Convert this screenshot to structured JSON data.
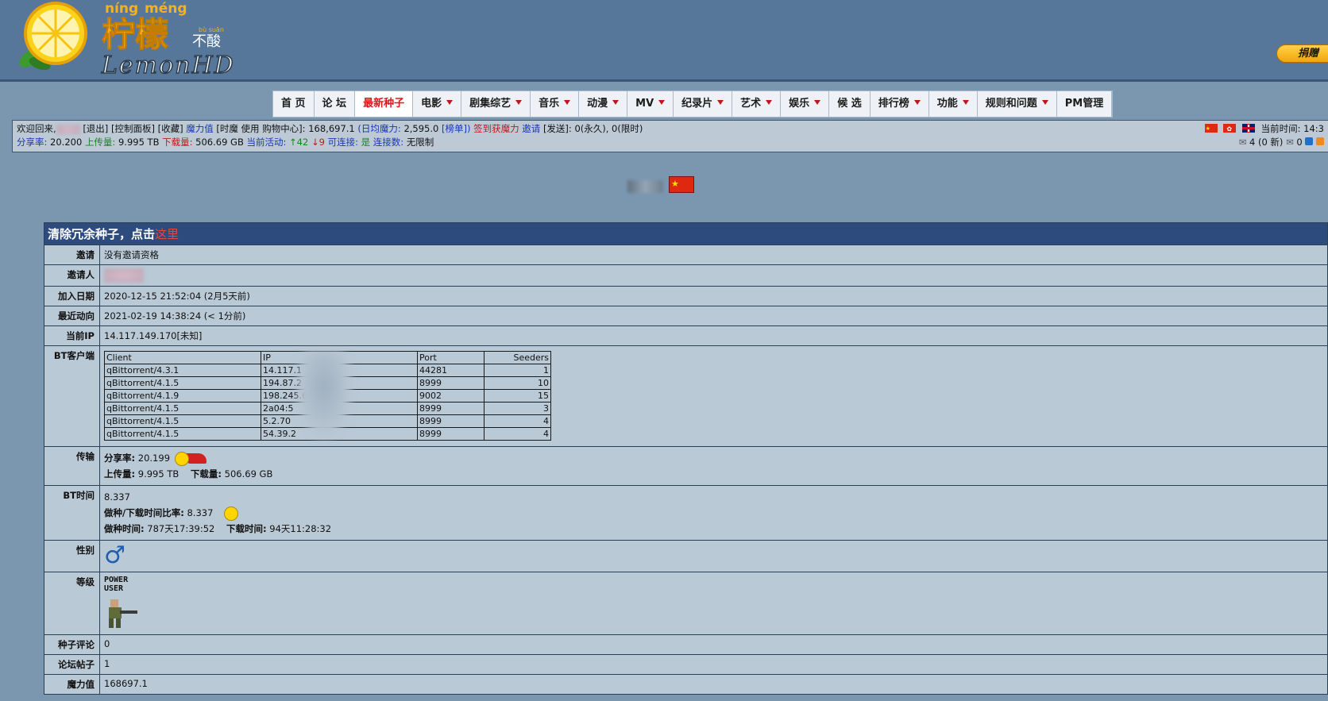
{
  "logo": {
    "pinyin_left": "níng",
    "pinyin_right": "méng",
    "chinese": "柠檬",
    "suffix": "不酸",
    "suffix_pinyin": "bù suān",
    "english": "LemonHD"
  },
  "donate": {
    "label": "捐赠"
  },
  "nav": {
    "items": [
      {
        "label": "首 页",
        "dropdown": false,
        "active": false
      },
      {
        "label": "论 坛",
        "dropdown": false,
        "active": false
      },
      {
        "label": "最新种子",
        "dropdown": false,
        "active": true
      },
      {
        "label": "电影",
        "dropdown": true,
        "active": false
      },
      {
        "label": "剧集综艺",
        "dropdown": true,
        "active": false
      },
      {
        "label": "音乐",
        "dropdown": true,
        "active": false
      },
      {
        "label": "动漫",
        "dropdown": true,
        "active": false
      },
      {
        "label": "MV",
        "dropdown": true,
        "active": false
      },
      {
        "label": "纪录片",
        "dropdown": true,
        "active": false
      },
      {
        "label": "艺术",
        "dropdown": true,
        "active": false
      },
      {
        "label": "娱乐",
        "dropdown": true,
        "active": false
      },
      {
        "label": "候 选",
        "dropdown": false,
        "active": false
      },
      {
        "label": "排行榜",
        "dropdown": true,
        "active": false
      },
      {
        "label": "功能",
        "dropdown": true,
        "active": false
      },
      {
        "label": "规则和问题",
        "dropdown": true,
        "active": false
      },
      {
        "label": "PM管理",
        "dropdown": false,
        "active": false
      }
    ]
  },
  "info": {
    "welcome": "欢迎回来,",
    "logout": "[退出]",
    "panel": "[控制面板]",
    "fav": "[收藏]",
    "magic_label": "魔力值",
    "magic_mid": "[时魔 使用 购物中心]:",
    "magic_value": "168,697.1",
    "daily_label": "(日均魔力:",
    "daily_value": "2,595.0",
    "rank": "[榜单])",
    "signin": "签到获魔力",
    "invite": "邀请",
    "send": "[发送]:",
    "send_value": "0(永久), 0(限时)",
    "ratio_label": "分享率:",
    "ratio_value": "20.200",
    "upload_label": "上传量:",
    "upload_value": "9.995 TB",
    "download_label": "下载量:",
    "download_value": "506.69 GB",
    "active_label": "当前活动:",
    "active_up": "↑42",
    "active_down": "↓9",
    "connectable_label": "可连接:",
    "connectable_value": "是",
    "connlimit_label": "连接数:",
    "connlimit_value": "无限制",
    "time_label": "当前时间:",
    "time_value": "14:3",
    "messages": "4 (0 新)",
    "msg_count2": "0"
  },
  "profile": {
    "header": "清除冗余种子，点击",
    "header_link": "这里",
    "rows": {
      "invite_label": "邀请",
      "invite_value": "没有邀请资格",
      "inviter_label": "邀请人",
      "join_label": "加入日期",
      "join_value": "2020-12-15 21:52:04 (2月5天前)",
      "last_label": "最近动向",
      "last_value": "2021-02-19 14:38:24 (< 1分前)",
      "ip_label": "当前IP",
      "ip_value": "14.117.149.170[未知]",
      "bt_label": "BT客户端",
      "transfer_label": "传输",
      "ratio_label": "分享率:",
      "ratio_value": "20.199",
      "up_label": "上传量:",
      "up_value": "9.995 TB",
      "down_label": "下载量:",
      "down_value": "506.69 GB",
      "bttime_label": "BT时间",
      "bttime_value": "8.337",
      "seedratio_label": "做种/下载时间比率:",
      "seedratio_value": "8.337",
      "seedtime_label": "做种时间:",
      "seedtime_value": "787天17:39:52",
      "dltime_label": "下载时间:",
      "dltime_value": "94天11:28:32",
      "gender_label": "性别",
      "gender_symbol": "♂",
      "level_label": "等级",
      "level_line1": "POWER",
      "level_line2": "USER",
      "comments_label": "种子评论",
      "comments_value": "0",
      "posts_label": "论坛帖子",
      "posts_value": "1",
      "magic_label": "魔力值",
      "magic_value": "168697.1"
    },
    "clients": {
      "headers": [
        "Client",
        "IP",
        "Port",
        "Seeders"
      ],
      "rows": [
        [
          "qBittorrent/4.3.1",
          "14.117.1",
          "44281",
          "1"
        ],
        [
          "qBittorrent/4.1.5",
          "194.87.2",
          "8999",
          "10"
        ],
        [
          "qBittorrent/4.1.9",
          "198.245.61",
          "9002",
          "15"
        ],
        [
          "qBittorrent/4.1.5",
          "2a04:5",
          "8999",
          "3"
        ],
        [
          "qBittorrent/4.1.5",
          "5.2.70",
          "8999",
          "4"
        ],
        [
          "qBittorrent/4.1.5",
          "54.39.2",
          "8999",
          "4"
        ]
      ]
    }
  },
  "colors": {
    "header_bg": "#56779a",
    "page_bg": "#7b97b0",
    "table_bg": "#bac9d6",
    "table_head": "#2d4b7c",
    "accent_red": "#e0181b"
  }
}
